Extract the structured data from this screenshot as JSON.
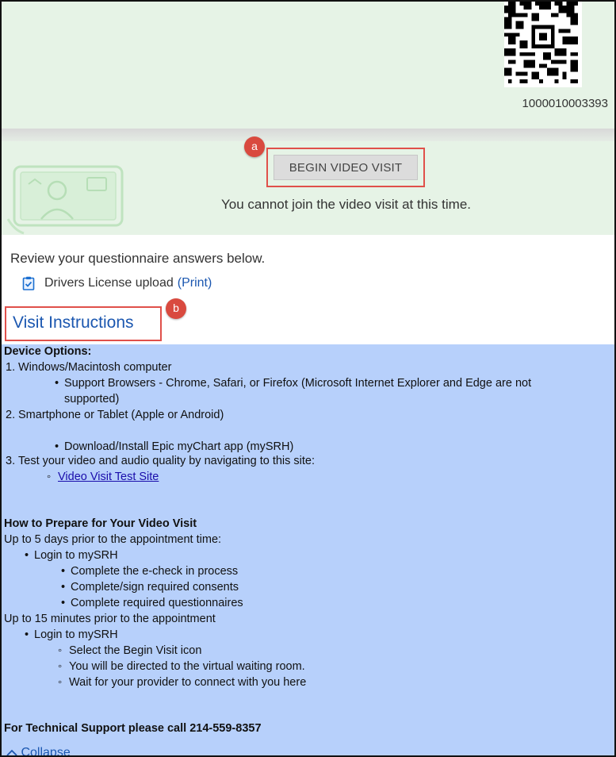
{
  "barcode": {
    "number": "1000010003393"
  },
  "video": {
    "button_label": "BEGIN VIDEO VISIT",
    "status_text": "You cannot join the video visit at this time.",
    "badge_a": "a"
  },
  "review": {
    "intro": "Review your questionnaire answers below.",
    "questionnaire_name": "Drivers License upload",
    "print_label": "(Print)"
  },
  "visit_instructions": {
    "title": "Visit Instructions",
    "badge_b": "b",
    "device_options_heading": "Device Options:",
    "item1_num": "1.",
    "item1": "Windows/Macintosh computer",
    "item1_sub_a": "Support Browsers - Chrome, Safari, or Firefox (Microsoft Internet Explorer and Edge are not",
    "item1_sub_b": "supported)",
    "item2_num": "2.",
    "item2": "Smartphone or Tablet (Apple or Android)",
    "item2_sub": "Download/Install Epic myChart app (mySRH)",
    "item3_num": "3.",
    "item3": "Test your video and audio quality by navigating to this site:",
    "test_link": "Video Visit Test Site",
    "prepare_heading": "How to Prepare for Your Video Visit",
    "days_prior": "Up to 5 days prior to the appointment time:",
    "login1": "Login to mySRH",
    "echeck": "Complete the e-check in process",
    "consents": "Complete/sign required consents",
    "questionnaires": "Complete required questionnaires",
    "minutes_prior": "Up to 15 minutes prior to the appointment",
    "login2": "Login to mySRH",
    "select_icon": "Select the Begin Visit icon",
    "directed": "You will be directed to the virtual waiting room.",
    "wait": "Wait for your provider to connect with you here",
    "support": "For Technical Support please call 214-559-8357",
    "collapse": "Collapse"
  },
  "colors": {
    "panel_green": "#e6f3e6",
    "instructions_blue": "#b7d0fb",
    "annotation_red": "#e0504a",
    "link_blue": "#1b57b0"
  }
}
